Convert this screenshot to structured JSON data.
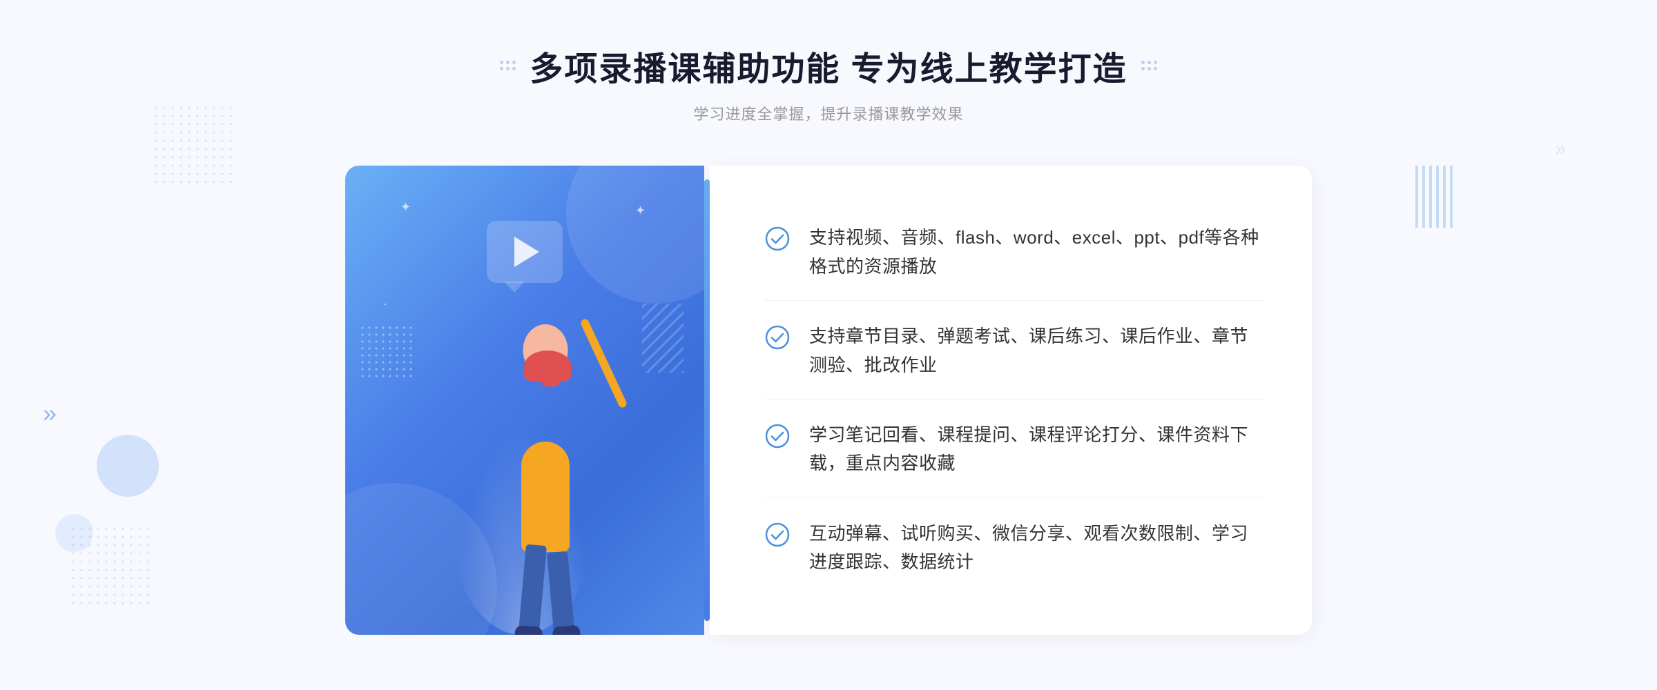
{
  "header": {
    "title": "多项录播课辅助功能 专为线上教学打造",
    "subtitle": "学习进度全掌握，提升录播课教学效果"
  },
  "features": [
    {
      "id": 1,
      "text": "支持视频、音频、flash、word、excel、ppt、pdf等各种格式的资源播放"
    },
    {
      "id": 2,
      "text": "支持章节目录、弹题考试、课后练习、课后作业、章节测验、批改作业"
    },
    {
      "id": 3,
      "text": "学习笔记回看、课程提问、课程评论打分、课件资料下载，重点内容收藏"
    },
    {
      "id": 4,
      "text": "互动弹幕、试听购买、微信分享、观看次数限制、学习进度跟踪、数据统计"
    }
  ],
  "colors": {
    "accent": "#4a7de8",
    "title": "#1a1a2e",
    "text": "#333333",
    "subtitle": "#999999",
    "check": "#4a90d9",
    "border": "#f0f2f7"
  }
}
